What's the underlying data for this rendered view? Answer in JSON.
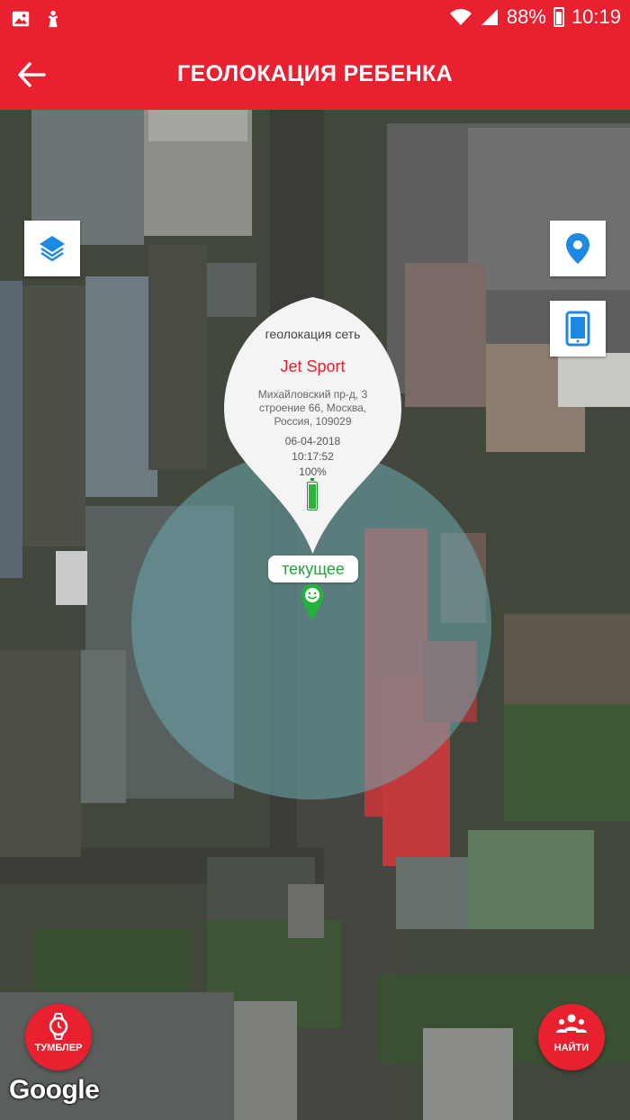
{
  "status_bar": {
    "battery_percent": "88%",
    "time": "10:19",
    "icons": [
      "gallery-icon",
      "child-icon",
      "wifi-icon",
      "signal-icon",
      "battery-icon"
    ]
  },
  "app_bar": {
    "title": "ГЕОЛОКАЦИЯ РЕБЕНКА",
    "back_icon": "arrow-back-icon"
  },
  "map": {
    "buttons": {
      "layers_icon": "layers-icon",
      "location_icon": "location-pin-icon",
      "device_icon": "phone-icon"
    },
    "info_window": {
      "title": "геолокация сеть",
      "name": "Jet Sport",
      "address": "Михайловский пр-д, 3 строение 66, Москва, Россия, 109029",
      "date": "06-04-2018",
      "time": "10:17:52",
      "battery": "100%",
      "battery_level": 1.0
    },
    "current_label": "текущее",
    "attribution": "Google"
  },
  "actions": {
    "tumbler_label": "ТУМБЛЕР",
    "find_label": "НАЙТИ"
  },
  "colors": {
    "accent": "#e8202f",
    "pin": "#22b33b",
    "map_icon": "#1e88e5"
  }
}
